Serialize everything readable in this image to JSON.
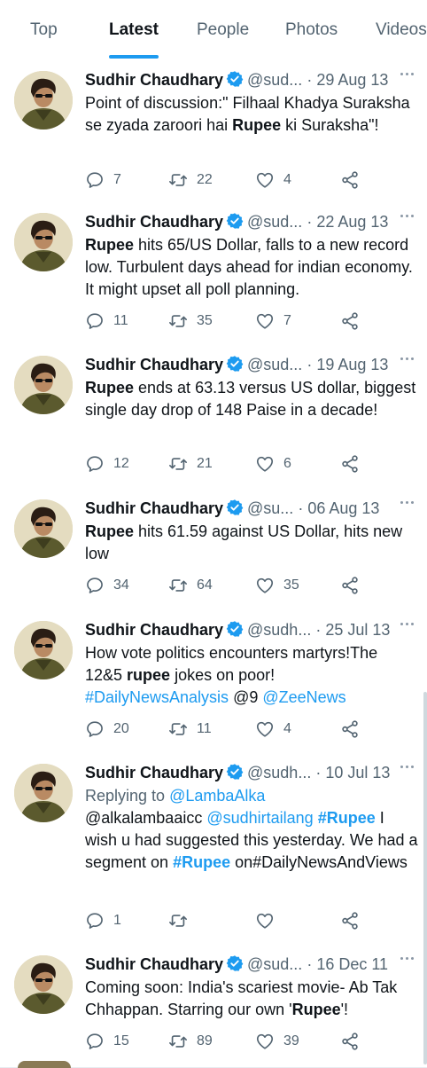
{
  "tabs": [
    {
      "label": "Top",
      "active": false
    },
    {
      "label": "Latest",
      "active": true
    },
    {
      "label": "People",
      "active": false
    },
    {
      "label": "Photos",
      "active": false
    },
    {
      "label": "Videos",
      "active": false
    }
  ],
  "colors": {
    "link": "#1d9bf0",
    "verified": "#1d9bf0",
    "muted": "#536471",
    "divider": "#e6ecf0"
  },
  "tweets": [
    {
      "name": "Sudhir Chaudhary",
      "handle": "@sud...",
      "date": "29 Aug 13",
      "segments": [
        {
          "t": "Point of discussion:\" Filhaal Khadya Suraksha se zyada zaroori hai "
        },
        {
          "t": "Rupee",
          "b": true
        },
        {
          "t": " ki Suraksha\"!"
        }
      ],
      "replies": "7",
      "retweets": "22",
      "likes": "4"
    },
    {
      "name": "Sudhir Chaudhary",
      "handle": "@sud...",
      "date": "22 Aug 13",
      "segments": [
        {
          "t": "Rupee",
          "b": true
        },
        {
          "t": " hits 65/US Dollar, falls to a new record low. Turbulent days ahead for indian economy. It might upset all poll planning."
        }
      ],
      "replies": "11",
      "retweets": "35",
      "likes": "7"
    },
    {
      "name": "Sudhir Chaudhary",
      "handle": "@sud...",
      "date": "19 Aug 13",
      "segments": [
        {
          "t": "Rupee",
          "b": true
        },
        {
          "t": " ends at 63.13 versus US dollar, biggest single day drop of 148 Paise in a decade!"
        }
      ],
      "replies": "12",
      "retweets": "21",
      "likes": "6"
    },
    {
      "name": "Sudhir Chaudhary",
      "handle": "@su...",
      "date": "06 Aug 13",
      "segments": [
        {
          "t": "Rupee",
          "b": true
        },
        {
          "t": " hits 61.59 against US Dollar, hits new low"
        }
      ],
      "replies": "34",
      "retweets": "64",
      "likes": "35"
    },
    {
      "name": "Sudhir Chaudhary",
      "handle": "@sudh...",
      "date": "25 Jul 13",
      "segments": [
        {
          "t": "How vote politics encounters martyrs!The 12&5 "
        },
        {
          "t": "rupee",
          "b": true
        },
        {
          "t": " jokes on poor! "
        },
        {
          "t": "#DailyNewsAnalysis",
          "l": true
        },
        {
          "t": " @9 "
        },
        {
          "t": "@ZeeNews",
          "l": true
        }
      ],
      "replies": "20",
      "retweets": "11",
      "likes": "4"
    },
    {
      "name": "Sudhir Chaudhary",
      "handle": "@sudh...",
      "date": "10 Jul 13",
      "reply_label": "Replying to ",
      "reply_handle": "@LambaAlka",
      "segments": [
        {
          "t": "@alkalambaaicc "
        },
        {
          "t": "@sudhirtailang",
          "l": true
        },
        {
          "t": " "
        },
        {
          "t": "#Rupee",
          "l": true,
          "b": true
        },
        {
          "t": " I wish u had suggested this yesterday. We had a segment on "
        },
        {
          "t": "#Rupee",
          "l": true,
          "b": true
        },
        {
          "t": " on#DailyNewsAndViews"
        }
      ],
      "replies": "1",
      "retweets": "",
      "likes": ""
    },
    {
      "name": "Sudhir Chaudhary",
      "handle": "@sud...",
      "date": "16 Dec 11",
      "segments": [
        {
          "t": "Coming soon: India's scariest movie- Ab Tak Chhappan. Starring our own '"
        },
        {
          "t": "Rupee",
          "b": true
        },
        {
          "t": "'!"
        }
      ],
      "replies": "15",
      "retweets": "89",
      "likes": "39"
    }
  ]
}
